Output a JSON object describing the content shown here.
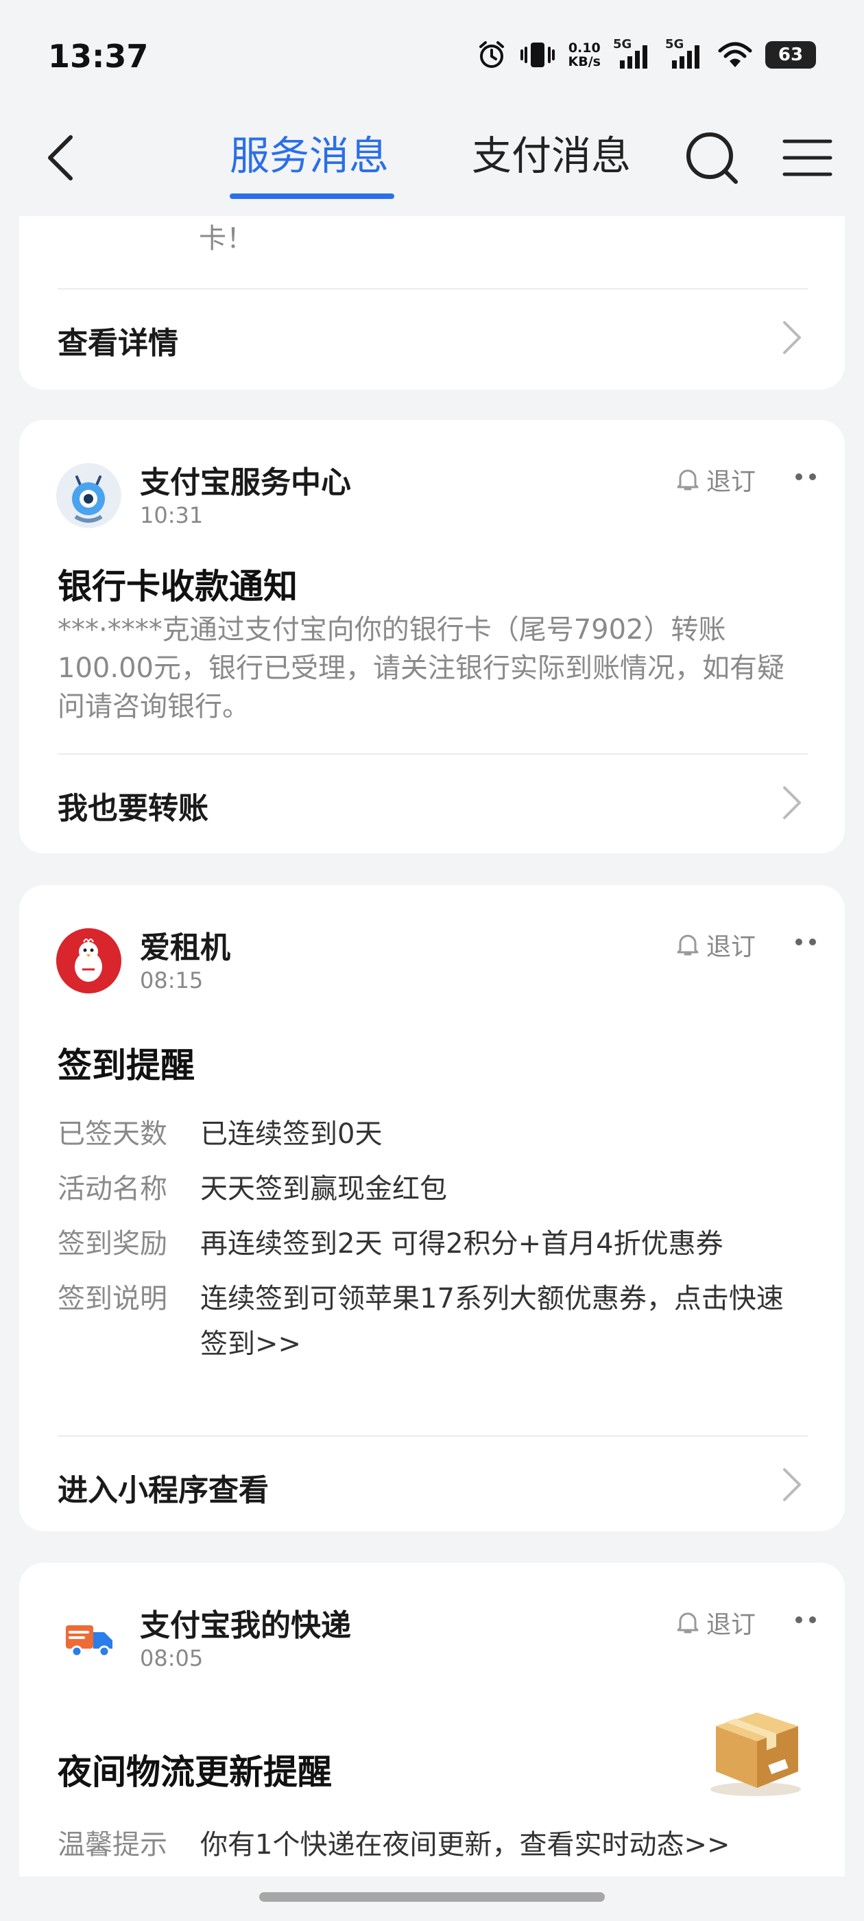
{
  "status": {
    "time": "13:37",
    "net_speed_value": "0.10",
    "net_speed_unit": "KB/s",
    "sim1": "5G",
    "sim2": "5G",
    "battery": "63"
  },
  "header": {
    "tab_service": "服务消息",
    "tab_pay": "支付消息",
    "active_color": "#2a6fe8"
  },
  "cards": {
    "top": {
      "partial_text": "卡！",
      "action": "查看详情"
    },
    "alipay_center": {
      "sender": "支付宝服务中心",
      "time": "10:31",
      "unsubscribe": "退订",
      "title": "银行卡收款通知",
      "body": "***·****克通过支付宝向你的银行卡（尾号7902）转账100.00元，银行已受理，请关注银行实际到账情况，如有疑问请咨询银行。",
      "action": "我也要转账"
    },
    "aizuji": {
      "sender": "爱租机",
      "time": "08:15",
      "unsubscribe": "退订",
      "title": "签到提醒",
      "rows": [
        {
          "k": "已签天数",
          "v": "已连续签到0天"
        },
        {
          "k": "活动名称",
          "v": "天天签到赢现金红包"
        },
        {
          "k": "签到奖励",
          "v": "再连续签到2天 可得2积分+首月4折优惠券"
        },
        {
          "k": "签到说明",
          "v": "连续签到可领苹果17系列大额优惠券，点击快速签到>>"
        }
      ],
      "action": "进入小程序查看"
    },
    "express": {
      "sender": "支付宝我的快递",
      "time": "08:05",
      "unsubscribe": "退订",
      "title": "夜间物流更新提醒",
      "row": {
        "k": "温馨提示",
        "v": "你有1个快递在夜间更新，查看实时动态>>"
      }
    }
  }
}
